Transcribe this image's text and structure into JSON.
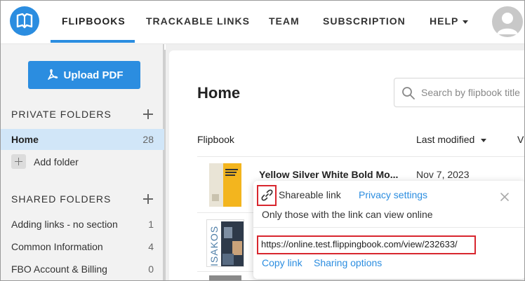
{
  "nav": {
    "items": [
      "FLIPBOOKS",
      "TRACKABLE LINKS",
      "TEAM",
      "SUBSCRIPTION",
      "HELP"
    ]
  },
  "sidebar": {
    "upload_label": "Upload PDF",
    "private_title": "PRIVATE FOLDERS",
    "home": {
      "label": "Home",
      "count": "28"
    },
    "add_folder": "Add folder",
    "shared_title": "SHARED FOLDERS",
    "shared_items": [
      {
        "label": "Adding links - no section",
        "count": "1"
      },
      {
        "label": "Common Information",
        "count": "4"
      },
      {
        "label": "FBO Account & Billing",
        "count": "0"
      }
    ]
  },
  "main": {
    "title": "Home",
    "search_placeholder": "Search by flipbook title",
    "col_flipbook": "Flipbook",
    "col_modified": "Last modified",
    "col_trunc": "V",
    "rows": [
      {
        "title": "Yellow Silver White Bold Mo...",
        "date": "Nov 7, 2023"
      }
    ],
    "thumb2_text": "ISAKOS"
  },
  "popup": {
    "shareable": "Shareable link",
    "privacy": "Privacy settings",
    "desc": "Only those with the link can view online",
    "url": "https://online.test.flippingbook.com/view/232633/",
    "copy": "Copy link",
    "sharing": "Sharing options"
  },
  "colors": {
    "accent": "#2b8de0",
    "highlight": "#d8262e",
    "active_bg": "#d1e6f8"
  }
}
